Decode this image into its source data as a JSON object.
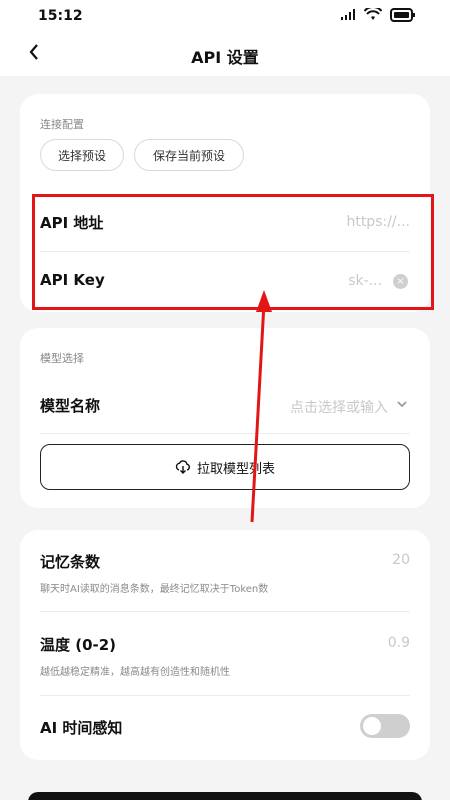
{
  "status_bar": {
    "time": "15:12",
    "icons": [
      "signal-icon",
      "wifi-icon",
      "battery-icon"
    ]
  },
  "nav": {
    "back_icon": "chevron-left-icon",
    "title": "API 设置"
  },
  "connection": {
    "section_label": "连接配置",
    "preset_select_label": "选择预设",
    "preset_save_label": "保存当前预设",
    "api_url_label": "API 地址",
    "api_url_placeholder": "https://...",
    "api_key_label": "API Key",
    "api_key_placeholder": "sk-...",
    "clear_icon": "close-circle-icon"
  },
  "model": {
    "section_label": "模型选择",
    "name_label": "模型名称",
    "name_placeholder": "点击选择或输入",
    "dropdown_icon": "chevron-down-icon",
    "fetch_button_label": "拉取模型列表",
    "fetch_icon": "cloud-download-icon"
  },
  "settings": {
    "memory_label": "记忆条数",
    "memory_value": "20",
    "memory_desc": "聊天时AI读取的消息条数，最终记忆取决于Token数",
    "temperature_label": "温度 (0-2)",
    "temperature_value": "0.9",
    "temperature_desc": "越低越稳定精准，越高越有创造性和随机性",
    "time_awareness_label": "AI 时间感知",
    "time_awareness_enabled": false
  },
  "colors": {
    "annotation": "#e21616",
    "card_bg": "#ffffff",
    "page_bg": "#f4f4f4"
  }
}
